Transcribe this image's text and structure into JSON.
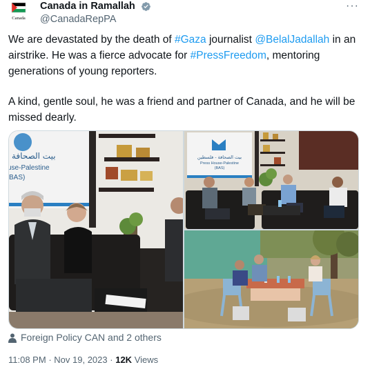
{
  "author": {
    "display_name": "Canada in Ramallah",
    "handle": "@CanadaRepPA",
    "verified_icon": "verified-badge-icon",
    "avatar_icon": "canada-palestine-flag-icon",
    "avatar_caption": "Canada"
  },
  "menu": {
    "more_label": "···"
  },
  "text": {
    "p1_a": "We are devastated by the death of ",
    "p1_hashtag_gaza": "#Gaza",
    "p1_b": " journalist ",
    "p1_mention": "@BelalJadallah",
    "p1_c": " in an airstrike. He was a fierce advocate for ",
    "p1_hashtag_press": "#PressFreedom",
    "p1_d": ", mentoring generations of young reporters.",
    "p2": "A kind, gentle soul, he was a friend and partner of Canada, and he will be missed dearly."
  },
  "media": {
    "photo1": {
      "sign_line1": "بيت الصحافة",
      "sign_line2": "use-Palestine",
      "sign_line3": "BAS)"
    },
    "photo2": {
      "sign_line1": "بيت الصحافة - فلسطين",
      "sign_line2": "Press House-Palestine",
      "sign_line3": "(BAS)"
    }
  },
  "tagged": {
    "label": "Foreign Policy CAN and 2 others",
    "icon": "person-icon"
  },
  "meta": {
    "time": "11:08 PM",
    "separator1": "·",
    "date": "Nov 19, 2023",
    "separator2": "·",
    "views_count": "12K",
    "views_label": "Views"
  },
  "colors": {
    "link": "#1d9bf0",
    "secondary": "#536471",
    "text": "#0f1419",
    "border": "#cfd9de"
  }
}
